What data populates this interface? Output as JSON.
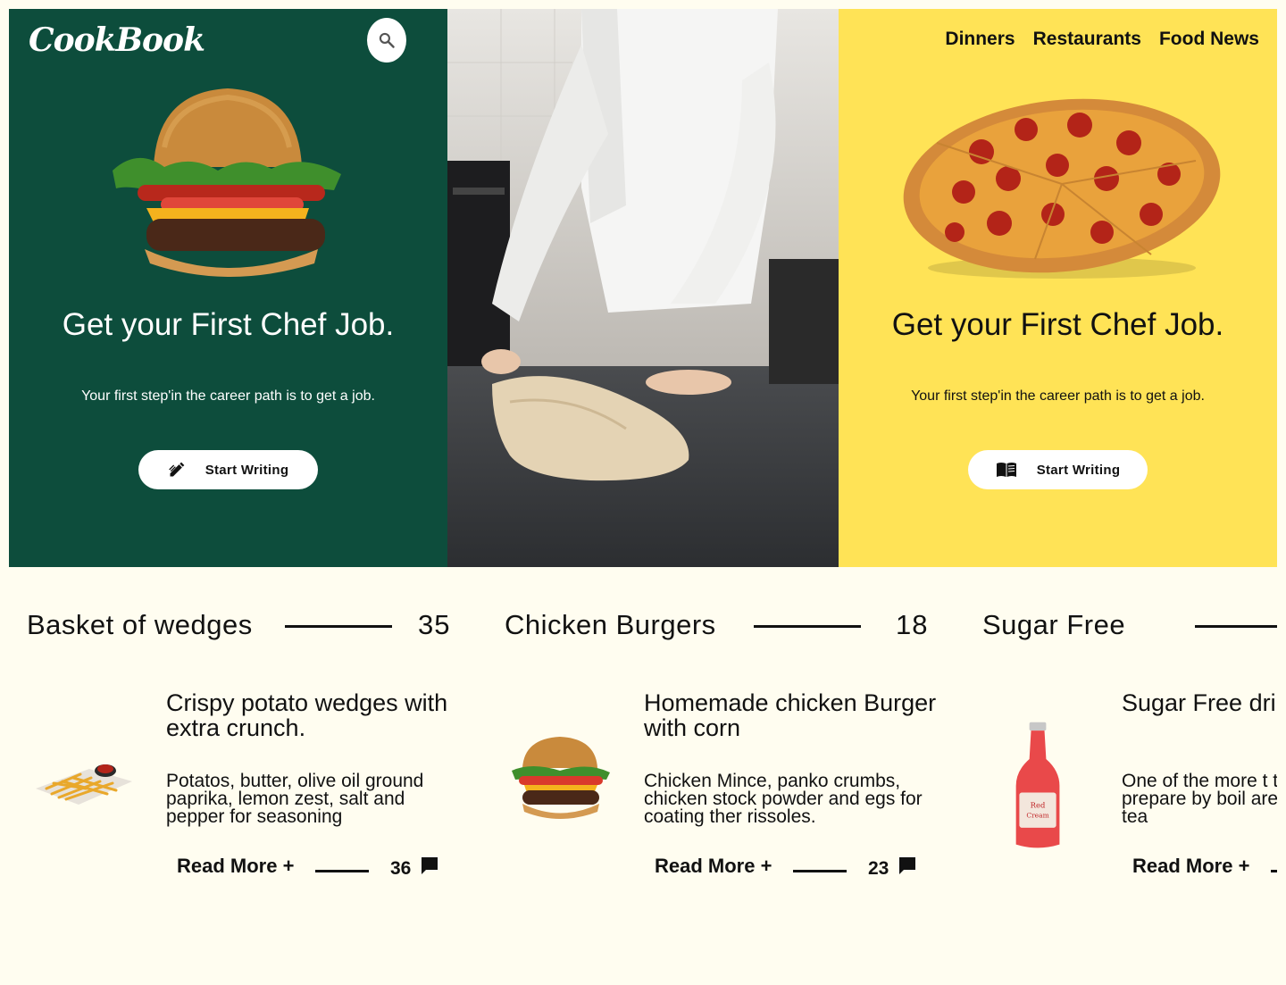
{
  "brand": {
    "logo_text": "CookBook"
  },
  "nav": {
    "items": [
      "Dinners",
      "Restaurants",
      "Food News"
    ]
  },
  "hero": {
    "left": {
      "title": "Get your First Chef Job.",
      "subtitle": "Your first step'in the career path is to get a job.",
      "cta_label": "Start Writing",
      "cta_icon": "edit-pencil-icon",
      "image": "burger"
    },
    "middle": {
      "image": "chef-kneading-dough-photo"
    },
    "right": {
      "title": "Get your First Chef Job.",
      "subtitle": "Your first step'in the career path is to get a job.",
      "cta_label": "Start Writing",
      "cta_icon": "menu-book-icon",
      "image": "pepperoni-pizza"
    }
  },
  "cards": [
    {
      "heading": "Basket of wedges",
      "count": "35",
      "title": "Crispy potato wedges with extra crunch.",
      "description": "Potatos, butter, olive oil ground paprika, lemon zest, salt and pepper for seasoning",
      "read_more": "Read More +",
      "comments": "36",
      "image": "fries-basket"
    },
    {
      "heading": "Chicken Burgers",
      "count": "18",
      "title": "Homemade chicken Burger with corn",
      "description": "Chicken Mince, panko crumbs, chicken stock powder and egs for coating ther rissoles.",
      "read_more": "Read More +",
      "comments": "23",
      "image": "burger"
    },
    {
      "heading": "Sugar Free",
      "count": "",
      "title": "Sugar Free dri your thirsty",
      "description": "One of the more t to prepare by boil are a green tea",
      "read_more": "Read More +",
      "comments": "",
      "image": "red-soda-bottle"
    }
  ],
  "colors": {
    "green": "#0d4d3c",
    "yellow": "#ffe356",
    "page_bg": "#fffdf0"
  }
}
